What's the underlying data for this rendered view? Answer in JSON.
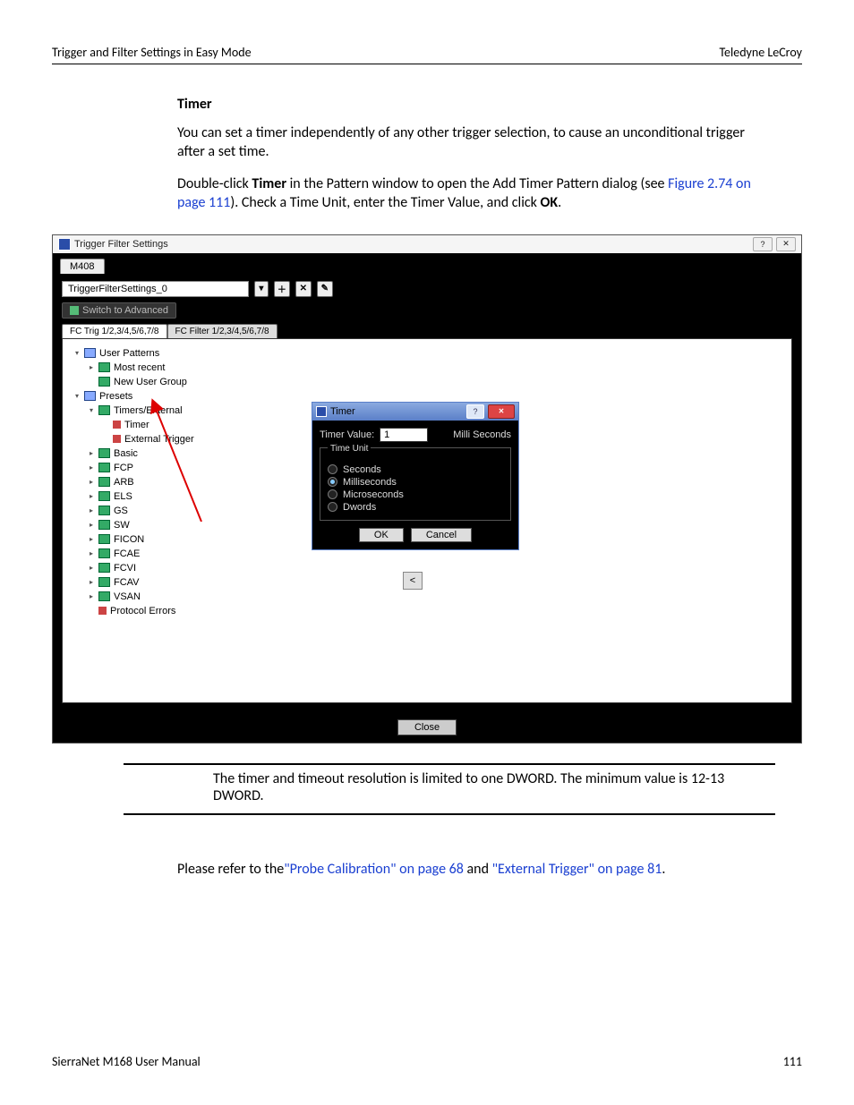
{
  "header": {
    "left": "Trigger and Filter Settings in Easy Mode",
    "right": "Teledyne LeCroy"
  },
  "section": {
    "title": "Timer",
    "para1": "You can set a timer independently of any other trigger selection, to cause an unconditional trigger after a set time.",
    "para2_a": "Double-click ",
    "para2_bold1": "Timer",
    "para2_b": " in the Pattern window to open the Add Timer Pattern dialog (see ",
    "para2_link": "Figure 2.74 on page 111",
    "para2_c": "). Check a Time Unit, enter the Timer Value, and click ",
    "para2_bold2": "OK",
    "para2_d": "."
  },
  "figure": {
    "win_title": "Trigger Filter Settings",
    "tab": "M408",
    "settings_name": "TriggerFilterSettings_0",
    "switch_btn": "Switch to Advanced",
    "subtab_trig": "FC Trig 1/2,3/4,5/6,7/8",
    "subtab_filter": "FC Filter 1/2,3/4,5/6,7/8",
    "tree": {
      "user_patterns": "User Patterns",
      "most_recent": "Most recent",
      "new_user_group": "New User Group",
      "presets": "Presets",
      "timers_ext": "Timers/External",
      "timer": "Timer",
      "external_trigger": "External Trigger",
      "basic": "Basic",
      "fcp": "FCP",
      "arb": "ARB",
      "els": "ELS",
      "gs": "GS",
      "sw": "SW",
      "ficon": "FICON",
      "fcae": "FCAE",
      "fcvi": "FCVI",
      "fcav": "FCAV",
      "vsan": "VSAN",
      "protocol_errors": "Protocol Errors"
    },
    "dialog": {
      "title": "Timer",
      "label": "Timer Value:",
      "value": "1",
      "suffix": "Milli Seconds",
      "group": "Time Unit",
      "opt_seconds": "Seconds",
      "opt_milliseconds": "Milliseconds",
      "opt_microseconds": "Microseconds",
      "opt_dwords": "Dwords",
      "ok": "OK",
      "cancel": "Cancel"
    },
    "close": "Close"
  },
  "note": "The timer and timeout resolution is limited to one DWORD. The minimum value is 12-13 DWORD.",
  "refs": {
    "lead": "Please refer to the",
    "link1": "\"Probe Calibration\" on page 68",
    "mid": " and ",
    "link2": "\"External Trigger\" on page 81",
    "tail": "."
  },
  "footer": {
    "left": "SierraNet M168 User Manual",
    "right": "111"
  }
}
